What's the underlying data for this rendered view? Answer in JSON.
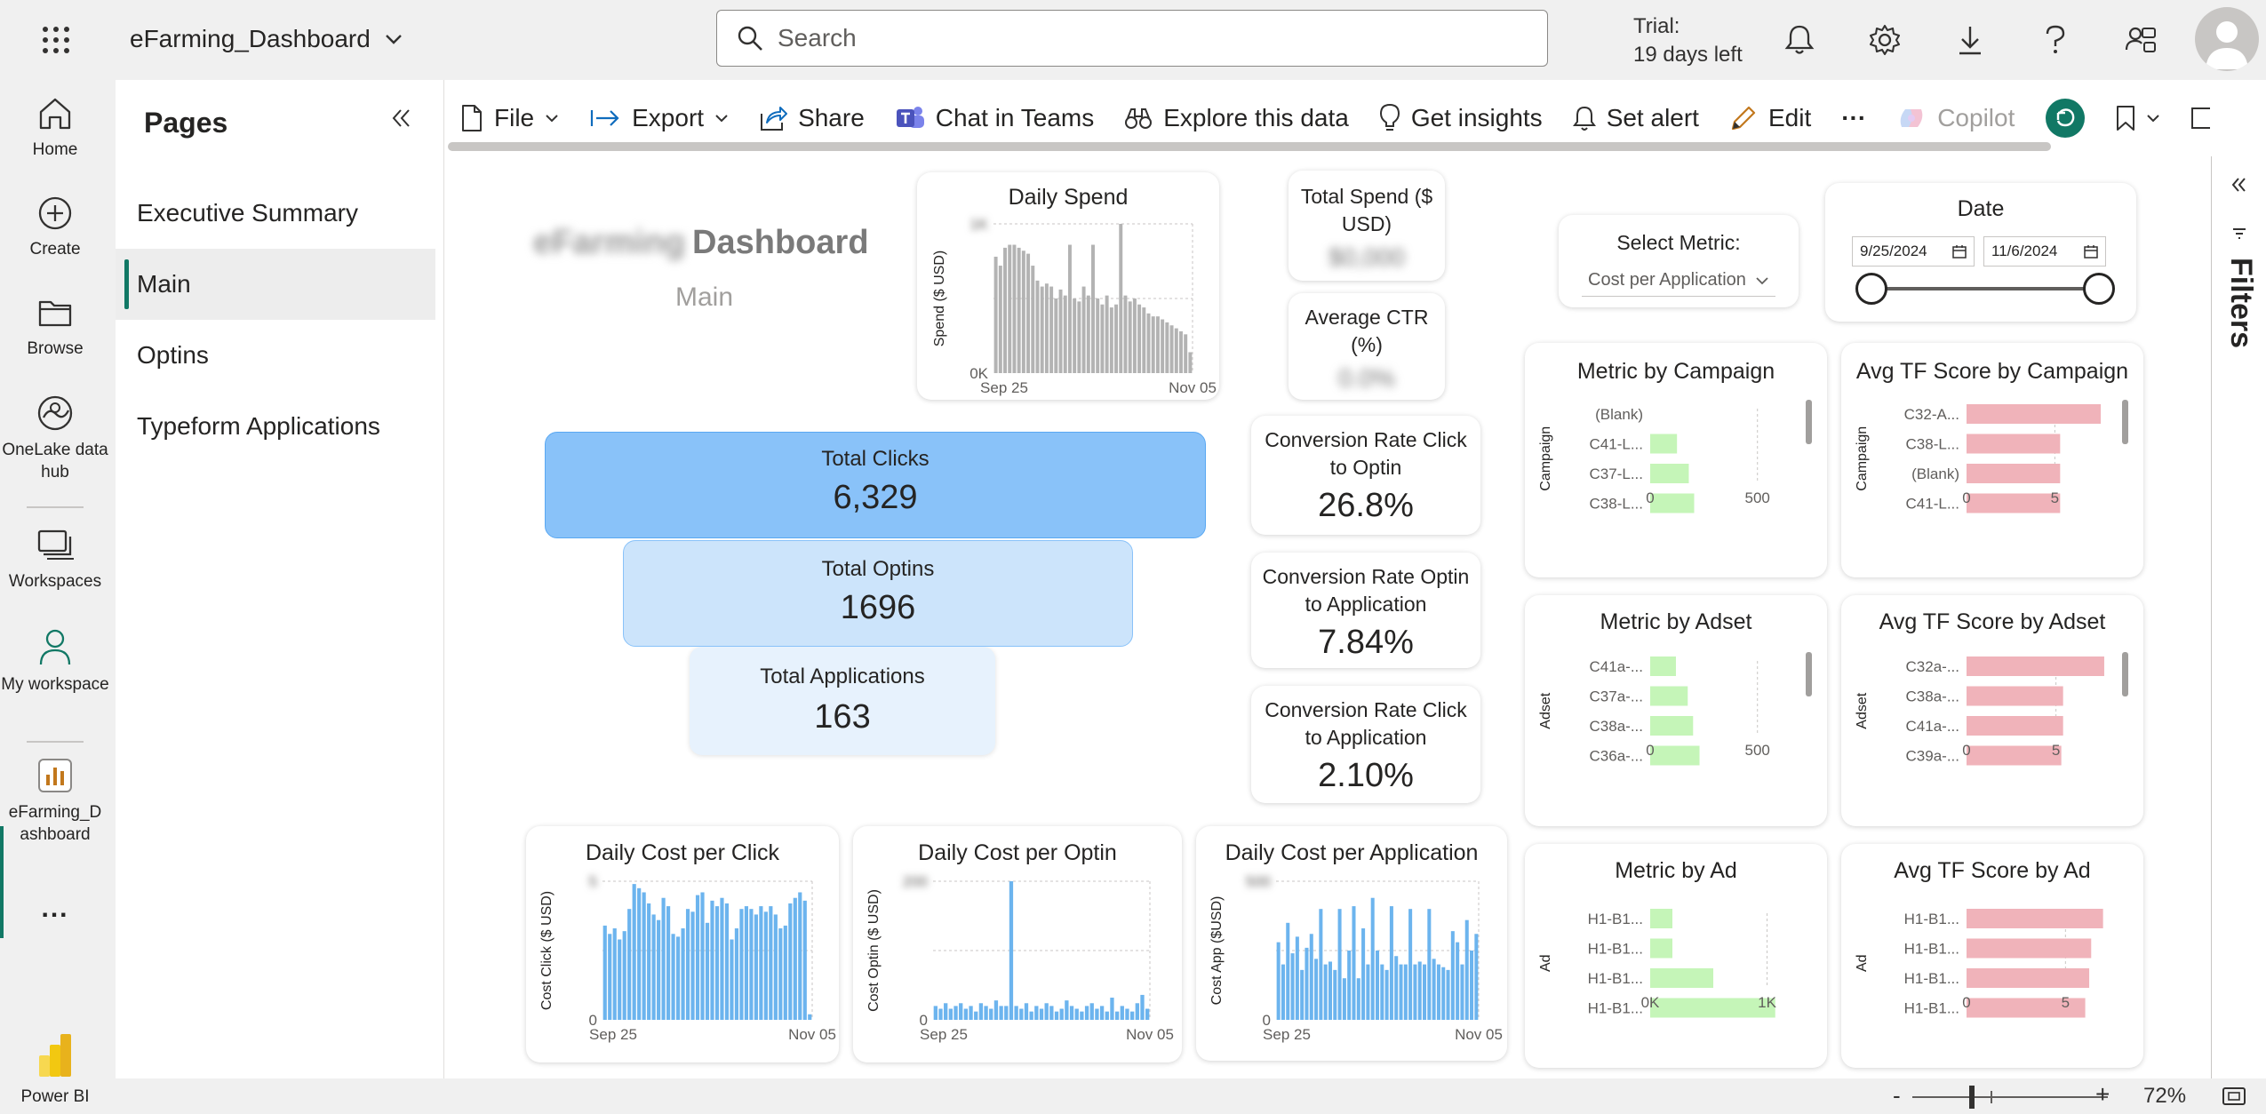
{
  "app": {
    "title": "eFarming_Dashboard",
    "search_placeholder": "Search",
    "trial_line1": "Trial:",
    "trial_line2": "19 days left"
  },
  "rail": {
    "items": [
      {
        "label": "Home"
      },
      {
        "label": "Create"
      },
      {
        "label": "Browse"
      },
      {
        "label": "OneLake data hub"
      },
      {
        "label": "Workspaces"
      },
      {
        "label": "My workspace"
      },
      {
        "label": "eFarming_D ashboard"
      }
    ],
    "more": "...",
    "product": "Power BI"
  },
  "pages": {
    "title": "Pages",
    "items": [
      {
        "label": "Executive Summary"
      },
      {
        "label": "Main"
      },
      {
        "label": "Optins"
      },
      {
        "label": "Typeform Applications"
      }
    ]
  },
  "toolbar": {
    "file": "File",
    "export": "Export",
    "share": "Share",
    "chat": "Chat in Teams",
    "explore": "Explore this data",
    "insights": "Get insights",
    "alert": "Set alert",
    "edit": "Edit",
    "more": "···",
    "copilot": "Copilot"
  },
  "report": {
    "title_blurred": "eFarming",
    "title": "Dashboard",
    "subtitle": "Main",
    "daily_spend": {
      "title": "Daily Spend",
      "ylabel": "Spend ($ USD)",
      "y0": "0K",
      "ytop_blurred": "1K",
      "x_start": "Sep 25",
      "x_end": "Nov 05"
    },
    "total_spend": {
      "label": "Total Spend ($ USD)",
      "value_blurred": "$0,000"
    },
    "avg_ctr": {
      "label": "Average CTR (%)",
      "value_blurred": "0.0%"
    },
    "select_metric": {
      "label": "Select Metric:",
      "value": "Cost per Application"
    },
    "date": {
      "label": "Date",
      "start": "9/25/2024",
      "end": "11/6/2024"
    },
    "funnel": [
      {
        "label": "Total Clicks",
        "value": "6,329"
      },
      {
        "label": "Total Optins",
        "value": "1696"
      },
      {
        "label": "Total Applications",
        "value": "163"
      }
    ],
    "cr1": {
      "label": "Conversion Rate Click to Optin",
      "value": "26.8%"
    },
    "cr2": {
      "label": "Conversion Rate Optin to Application",
      "value": "7.84%"
    },
    "cr3": {
      "label": "Conversion Rate Click to Application",
      "value": "2.10%"
    },
    "cost_click": {
      "title": "Daily Cost per Click",
      "ylabel": "Cost Click ($ USD)",
      "y0": "0",
      "ytop_blurred": "5",
      "x_start": "Sep 25",
      "x_end": "Nov 05"
    },
    "cost_optin": {
      "title": "Daily Cost per Optin",
      "ylabel": "Cost Optin ($ USD)",
      "y0": "0",
      "ytop_blurred": "200",
      "x_start": "Sep 25",
      "x_end": "Nov 05"
    },
    "cost_app": {
      "title": "Daily Cost per Application",
      "ylabel": "Cost App ($USD)",
      "y0": "0",
      "ytop_blurred": "500",
      "x_start": "Sep 25",
      "x_end": "Nov 05"
    },
    "metric_campaign": {
      "title": "Metric by Campaign",
      "axis_title": "Campaign",
      "ticks": [
        "0",
        "500"
      ]
    },
    "tf_campaign": {
      "title": "Avg TF Score by Campaign",
      "axis_title": "Campaign",
      "ticks": [
        "0",
        "5"
      ]
    },
    "metric_adset": {
      "title": "Metric by Adset",
      "axis_title": "Adset",
      "ticks": [
        "0",
        "500"
      ]
    },
    "tf_adset": {
      "title": "Avg TF Score by Adset",
      "axis_title": "Adset",
      "ticks": [
        "0",
        "5"
      ]
    },
    "metric_ad": {
      "title": "Metric by Ad",
      "axis_title": "Ad",
      "ticks": [
        "0K",
        "1K"
      ]
    },
    "tf_ad": {
      "title": "Avg TF Score by Ad",
      "axis_title": "Ad",
      "ticks": [
        "0",
        "5"
      ]
    }
  },
  "filters": {
    "label": "Filters"
  },
  "status": {
    "zoom": "72%",
    "minus": "-",
    "plus": "+"
  },
  "colors": {
    "accent_green": "#117865",
    "funnel_1": "#89c2f9",
    "funnel_2": "#cce4fb",
    "funnel_3": "#e7f2fd",
    "bar_gray": "#b3b3b3",
    "bar_blue": "#6cb4ee",
    "bar_green": "#c5f5b8",
    "bar_pink": "#f0b3ba"
  },
  "chart_data": [
    {
      "type": "bar",
      "title": "Daily Spend",
      "ylabel": "Spend ($ USD)",
      "x_start": "Sep 25",
      "x_end": "Nov 05",
      "values": [
        0.78,
        0.72,
        0.84,
        0.86,
        0.86,
        0.84,
        0.82,
        0.8,
        0.72,
        0.62,
        0.58,
        0.6,
        0.58,
        0.5,
        0.56,
        0.52,
        0.86,
        0.5,
        0.48,
        0.58,
        0.52,
        0.86,
        0.5,
        0.46,
        0.52,
        0.44,
        0.46,
        1.0,
        0.52,
        0.48,
        0.5,
        0.46,
        0.44,
        0.4,
        0.38,
        0.38,
        0.36,
        0.34,
        0.32,
        0.3,
        0.28,
        0.26,
        0.14
      ]
    },
    {
      "type": "bar",
      "title": "Daily Cost per Click",
      "ylabel": "Cost Click ($ USD)",
      "x_start": "Sep 25",
      "x_end": "Nov 05",
      "values": [
        0.68,
        0.62,
        0.66,
        0.58,
        0.64,
        0.8,
        0.98,
        0.95,
        0.92,
        0.84,
        0.76,
        0.72,
        0.88,
        0.82,
        0.62,
        0.6,
        0.66,
        0.8,
        0.78,
        0.9,
        0.92,
        0.7,
        0.86,
        0.82,
        0.88,
        0.84,
        0.58,
        0.66,
        0.8,
        0.82,
        0.8,
        0.76,
        0.82,
        0.78,
        0.82,
        0.76,
        0.66,
        0.68,
        0.84,
        0.88,
        0.92,
        0.86,
        0.04
      ]
    },
    {
      "type": "bar",
      "title": "Daily Cost per Optin",
      "ylabel": "Cost Optin ($ USD)",
      "x_start": "Sep 25",
      "x_end": "Nov 05",
      "values": [
        0.1,
        0.08,
        0.12,
        0.08,
        0.1,
        0.12,
        0.08,
        0.1,
        0.06,
        0.12,
        0.1,
        0.08,
        0.14,
        0.1,
        0.1,
        1.0,
        0.1,
        0.08,
        0.12,
        0.06,
        0.1,
        0.08,
        0.12,
        0.1,
        0.06,
        0.08,
        0.14,
        0.1,
        0.08,
        0.06,
        0.1,
        0.12,
        0.08,
        0.1,
        0.06,
        0.16,
        0.06,
        0.1,
        0.08,
        0.06,
        0.12,
        0.18,
        0.08
      ]
    },
    {
      "type": "bar",
      "title": "Daily Cost per Application",
      "ylabel": "Cost App ($USD)",
      "x_start": "Sep 25",
      "x_end": "Nov 05",
      "values": [
        0.56,
        0.4,
        0.7,
        0.48,
        0.6,
        0.36,
        0.52,
        0.62,
        0.44,
        0.8,
        0.4,
        0.42,
        0.36,
        0.8,
        0.3,
        0.5,
        0.82,
        0.3,
        0.66,
        0.4,
        0.88,
        0.5,
        0.4,
        0.36,
        0.82,
        0.46,
        0.4,
        0.4,
        0.8,
        0.4,
        0.42,
        0.4,
        0.8,
        0.44,
        0.4,
        0.38,
        0.36,
        0.64,
        0.56,
        0.4,
        0.72,
        0.5,
        0.62
      ]
    },
    {
      "type": "bar",
      "title": "Metric by Campaign",
      "ylabel": "Campaign",
      "categories": [
        "(Blank)",
        "C41-L...",
        "C37-L...",
        "C38-L..."
      ],
      "values": [
        0,
        125,
        180,
        205
      ],
      "xlim": [
        0,
        700
      ],
      "color": "#c5f5b8"
    },
    {
      "type": "bar",
      "title": "Avg TF Score by Campaign",
      "ylabel": "Campaign",
      "categories": [
        "C32-A...",
        "C38-L...",
        "(Blank)",
        "C41-L..."
      ],
      "values": [
        7.6,
        5.3,
        5.3,
        5.3
      ],
      "xlim": [
        0,
        8
      ],
      "color": "#f0b3ba"
    },
    {
      "type": "bar",
      "title": "Metric by Adset",
      "ylabel": "Adset",
      "categories": [
        "C41a-...",
        "C37a-...",
        "C38a-...",
        "C36a-..."
      ],
      "values": [
        120,
        175,
        200,
        230
      ],
      "xlim": [
        0,
        700
      ],
      "color": "#c5f5b8"
    },
    {
      "type": "bar",
      "title": "Avg TF Score by Adset",
      "ylabel": "Adset",
      "categories": [
        "C32a-...",
        "C38a-...",
        "C41a-...",
        "C39a-..."
      ],
      "values": [
        7.7,
        5.4,
        5.4,
        5.3
      ],
      "xlim": [
        0,
        8
      ],
      "color": "#f0b3ba"
    },
    {
      "type": "bar",
      "title": "Metric by Ad",
      "ylabel": "Ad",
      "categories": [
        "H1-B1...",
        "H1-B1...",
        "H1-B1...",
        "H1-B1..."
      ],
      "values": [
        190,
        190,
        540,
        1070
      ],
      "xlim": [
        0,
        1300
      ],
      "color": "#c5f5b8"
    },
    {
      "type": "bar",
      "title": "Avg TF Score by Ad",
      "ylabel": "Ad",
      "categories": [
        "H1-B1...",
        "H1-B1...",
        "H1-B1...",
        "H1-B1..."
      ],
      "values": [
        6.9,
        6.3,
        6.2,
        6.0
      ],
      "xlim": [
        0,
        7.5
      ],
      "color": "#f0b3ba"
    }
  ]
}
